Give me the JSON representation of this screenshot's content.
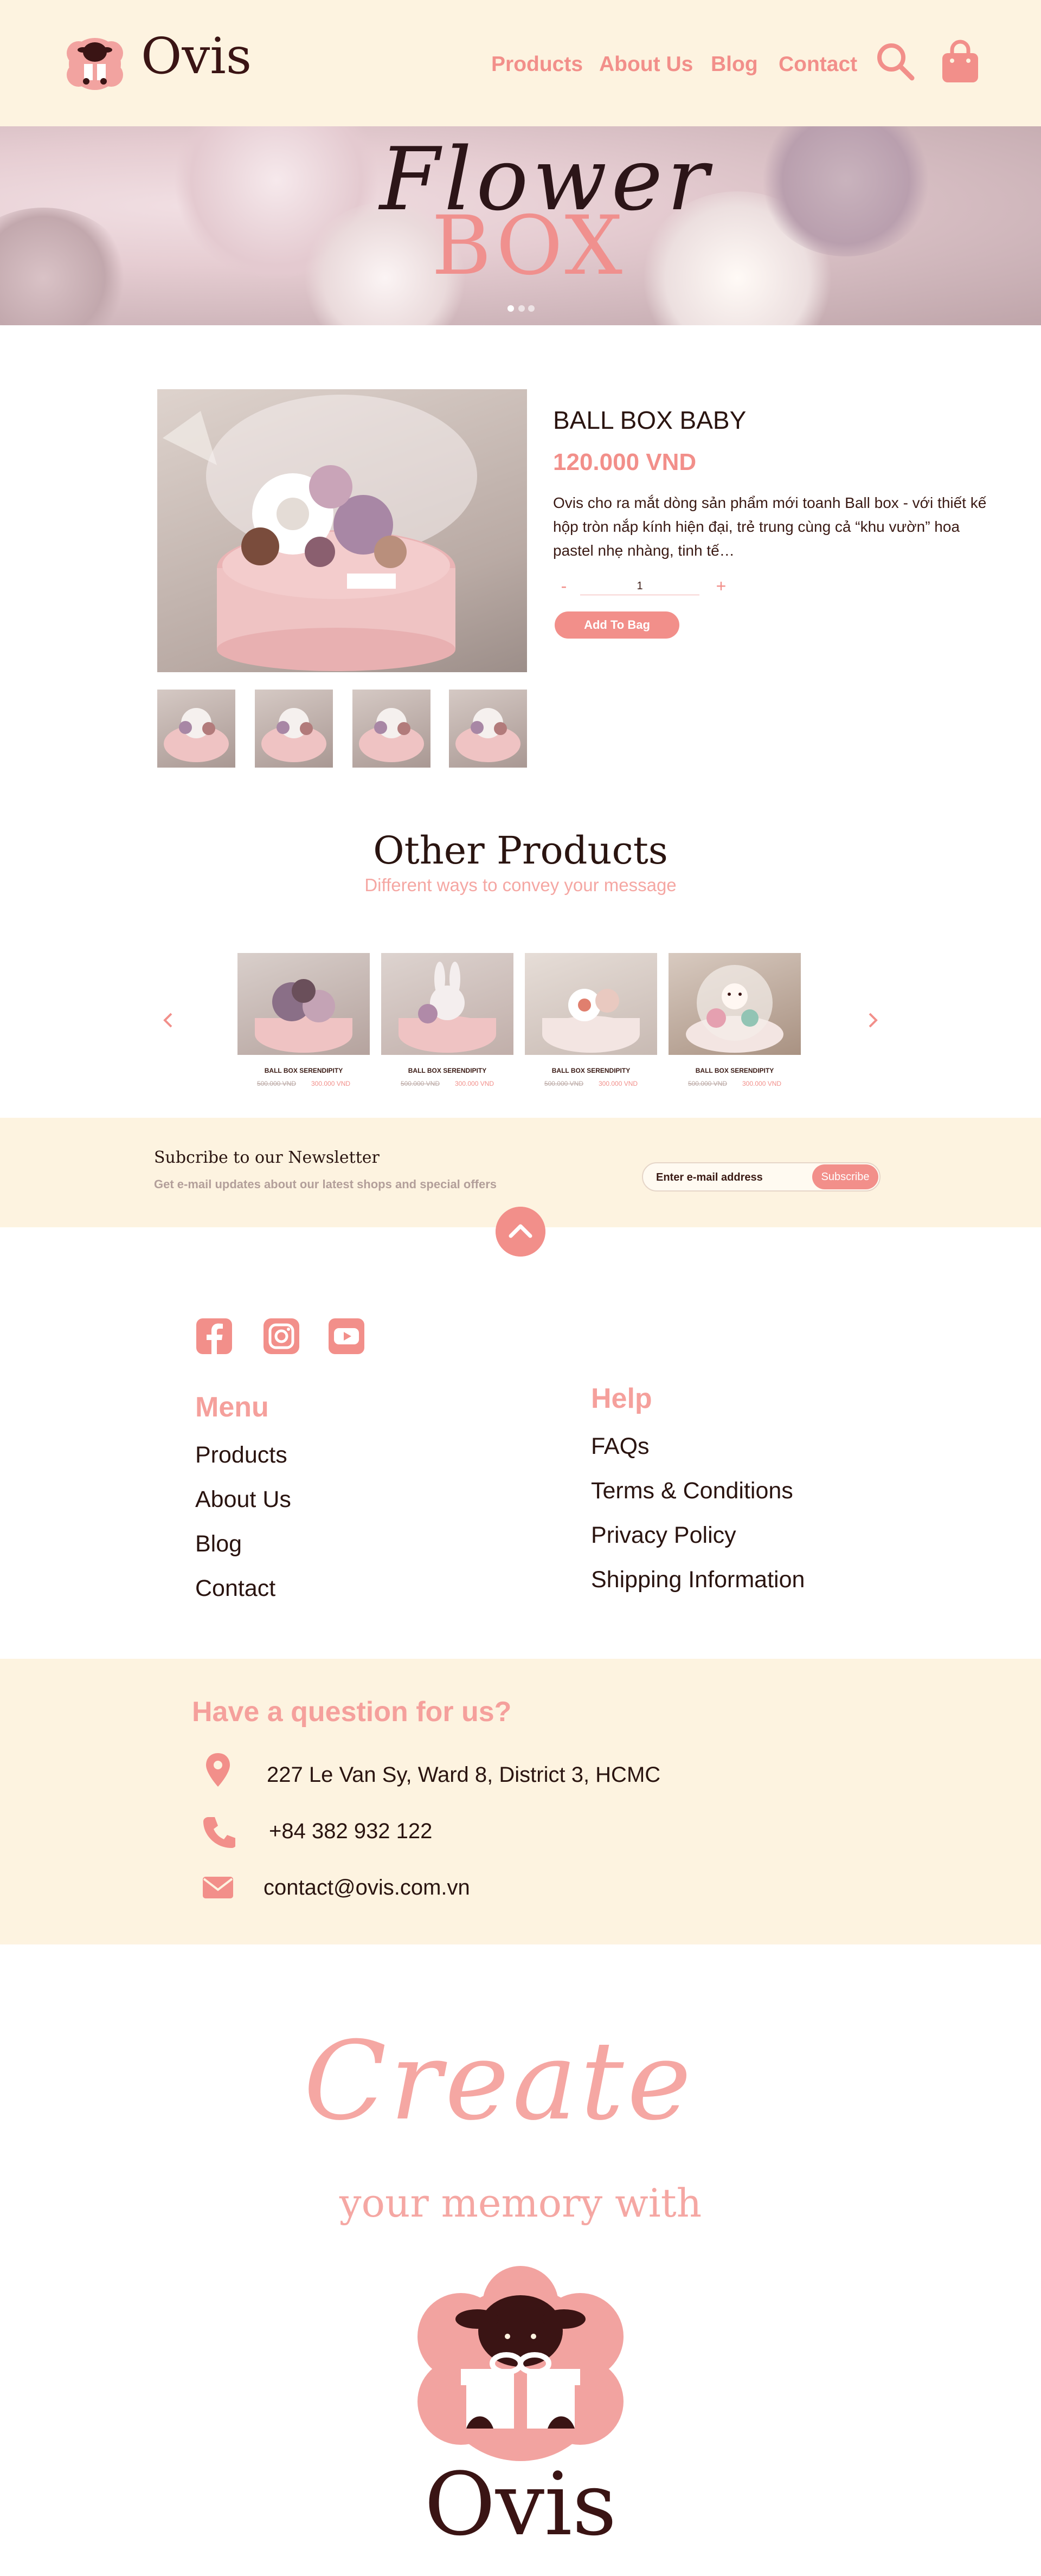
{
  "brand": {
    "name": "Ovis",
    "accent": "#f28f8a",
    "dark": "#3a1414",
    "cream": "#fdf3e0"
  },
  "header": {
    "nav": [
      "Products",
      "About Us",
      "Blog",
      "Contact"
    ],
    "icons": [
      "search-icon",
      "shopping-bag-icon"
    ]
  },
  "hero": {
    "script_text": "Flower",
    "title": "BOX",
    "slides": 3
  },
  "product": {
    "name": "BALL BOX BABY",
    "price": "120.000 VND",
    "description": "Ovis cho ra mắt dòng sản phẩm mới toanh Ball box - với thiết kế hộp tròn nắp kính hiện đại, trẻ trung cùng cả “khu vườn” hoa pastel nhẹ nhàng, tinh tế…",
    "quantity": {
      "minus": "-",
      "value": "1",
      "plus": "+"
    },
    "add_button": "Add To Bag",
    "thumbnails": 4
  },
  "other_products": {
    "title": "Other Products",
    "subtitle": "Different ways to convey your message",
    "items": [
      {
        "name": "BALL BOX SERENDIPITY",
        "old_price": "500.000 VND",
        "price": "300.000 VND"
      },
      {
        "name": "BALL BOX SERENDIPITY",
        "old_price": "500.000 VND",
        "price": "300.000 VND"
      },
      {
        "name": "BALL BOX SERENDIPITY",
        "old_price": "500.000 VND",
        "price": "300.000 VND"
      },
      {
        "name": "BALL BOX SERENDIPITY",
        "old_price": "500.000 VND",
        "price": "300.000 VND"
      }
    ]
  },
  "newsletter": {
    "title": "Subcribe to our Newsletter",
    "subtitle": "Get e-mail updates about our latest shops and special offers",
    "placeholder": "Enter e-mail address",
    "button": "Subscribe"
  },
  "footer": {
    "social": [
      "facebook-icon",
      "instagram-icon",
      "youtube-icon"
    ],
    "menu_title": "Menu",
    "menu": [
      "Products",
      "About Us",
      "Blog",
      "Contact"
    ],
    "help_title": "Help",
    "help": [
      "FAQs",
      "Terms & Conditions",
      "Privacy Policy",
      "Shipping Information"
    ]
  },
  "contact": {
    "title": "Have a question for us?",
    "address": "227 Le Van Sy, Ward 8,  District 3, HCMC",
    "phone": "+84 382 932 122",
    "email": "contact@ovis.com.vn"
  },
  "closing": {
    "script": "Create",
    "line": "your memory with",
    "brand": "Ovis"
  }
}
